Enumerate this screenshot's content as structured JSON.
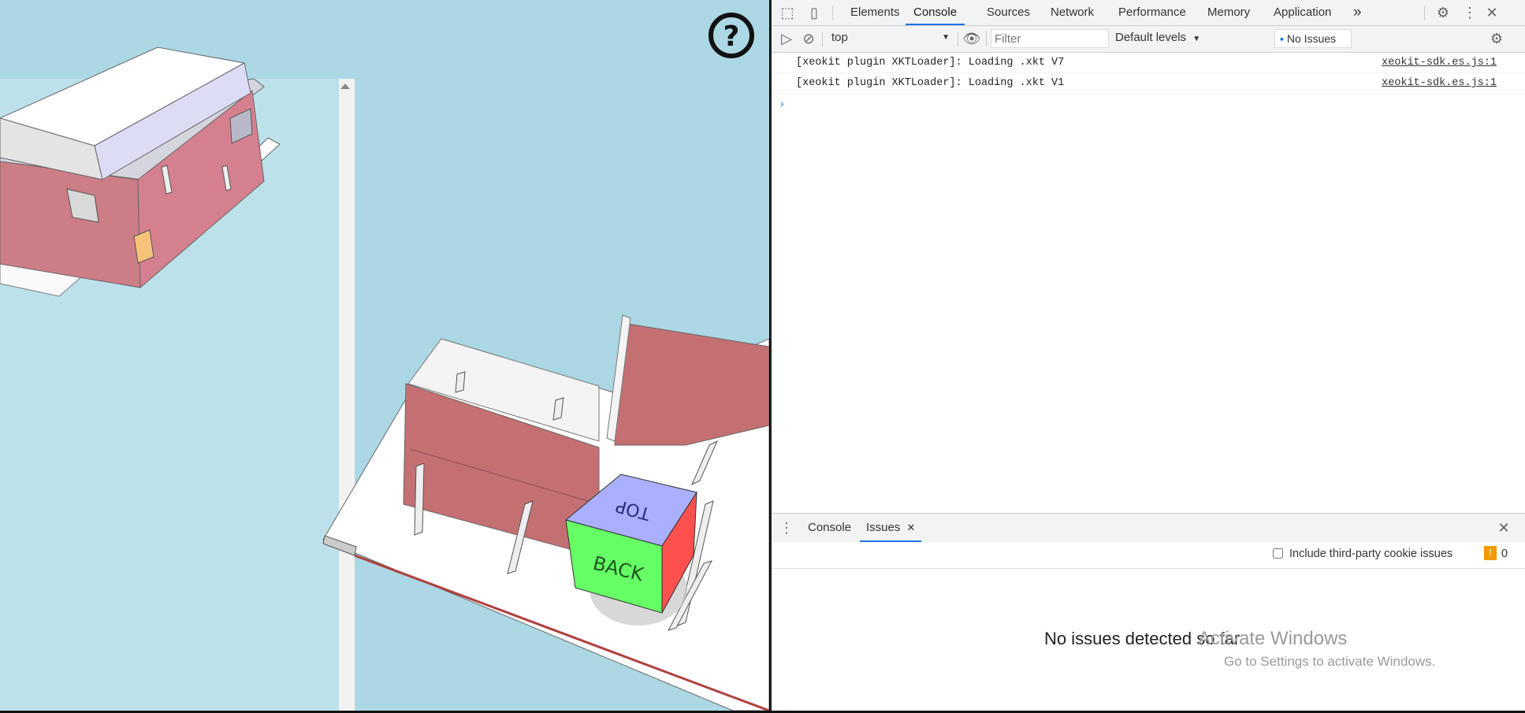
{
  "devtools": {
    "tabs": [
      "Elements",
      "Console",
      "Sources",
      "Network",
      "Performance",
      "Memory",
      "Application"
    ],
    "active_tab": "Console",
    "more_tabs": "»",
    "context": "top",
    "filter_placeholder": "Filter",
    "levels": "Default levels",
    "issues_button": "No Issues",
    "messages": [
      {
        "text": "[xeokit plugin XKTLoader]: Loading .xkt V7",
        "source": "xeokit-sdk.es.js:1"
      },
      {
        "text": "[xeokit plugin XKTLoader]: Loading .xkt V1",
        "source": "xeokit-sdk.es.js:1"
      }
    ],
    "prompt": "›"
  },
  "drawer": {
    "tabs": [
      "Console",
      "Issues"
    ],
    "active_tab": "Issues",
    "third_party_label": "Include third-party cookie issues",
    "issue_count": "0",
    "empty_message": "No issues detected so far"
  },
  "viewer": {
    "help_icon": "help-circle-icon",
    "navcube": {
      "top_label": "TOP",
      "back_label": "BACK",
      "top_color": "#aab0ff",
      "back_color": "#66ff66",
      "side_color": "#ff5050"
    }
  },
  "watermark": {
    "title": "Activate Windows",
    "subtitle": "Go to Settings to activate Windows."
  },
  "colors": {
    "wall": "#c47073",
    "sky": "#acd7e4",
    "accent": "#1a73e8"
  }
}
